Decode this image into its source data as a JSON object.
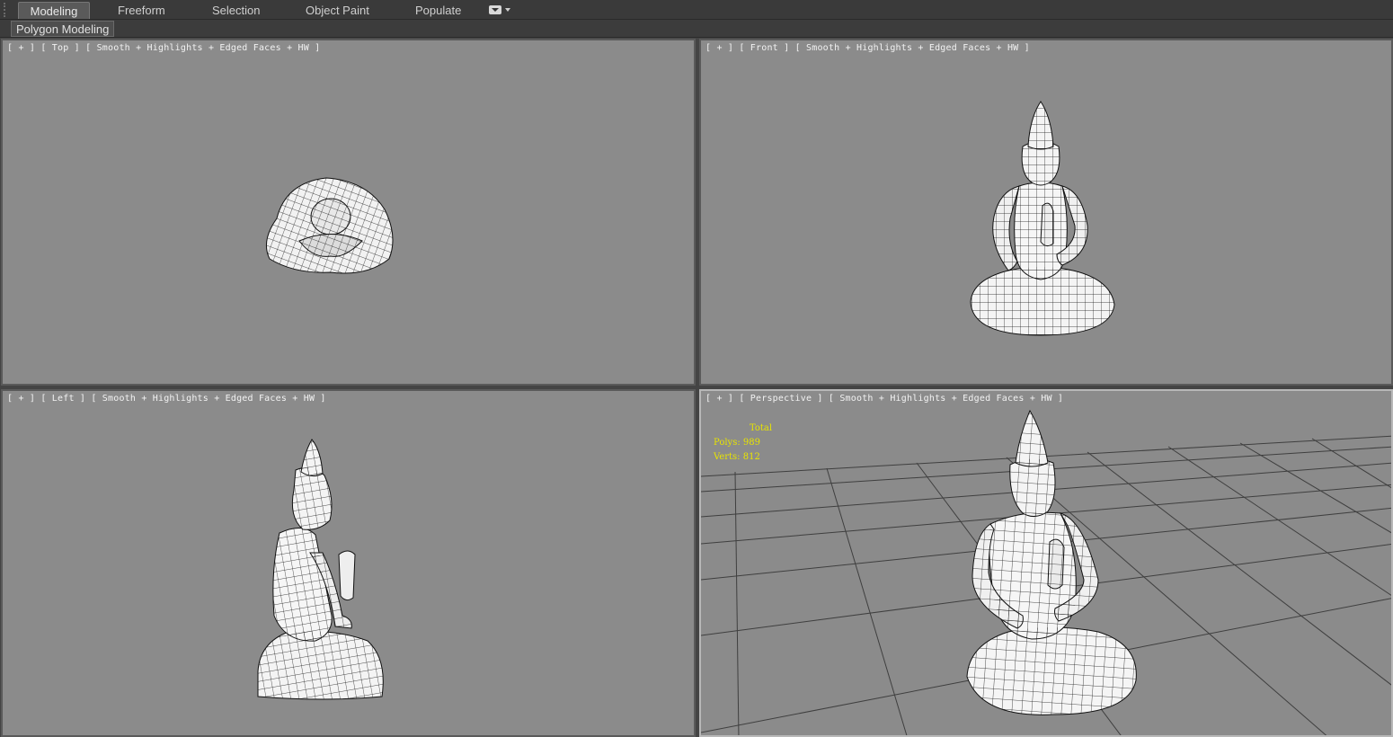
{
  "ribbon": {
    "tabs": [
      {
        "label": "Modeling",
        "active": true
      },
      {
        "label": "Freeform",
        "active": false
      },
      {
        "label": "Selection",
        "active": false
      },
      {
        "label": "Object Paint",
        "active": false
      },
      {
        "label": "Populate",
        "active": false
      }
    ],
    "panel_label": "Polygon Modeling"
  },
  "viewports": {
    "top": {
      "plus": "[ + ]",
      "view": "[ Top ]",
      "shading": "[ Smooth + Highlights + Edged Faces + HW ]"
    },
    "front": {
      "plus": "[ + ]",
      "view": "[ Front ]",
      "shading": "[ Smooth + Highlights + Edged Faces + HW ]"
    },
    "left": {
      "plus": "[ + ]",
      "view": "[ Left ]",
      "shading": "[ Smooth + Highlights + Edged Faces + HW ]"
    },
    "perspective": {
      "plus": "[ + ]",
      "view": "[ Perspective ]",
      "shading": "[ Smooth + Highlights + Edged Faces + HW ]"
    }
  },
  "statistics": {
    "header": "Total",
    "polys_label": "Polys:",
    "polys_value": "989",
    "verts_label": "Verts:",
    "verts_value": "812"
  },
  "colors": {
    "viewport_bg": "#8b8b8b",
    "ui_dark": "#3a3a3a",
    "stats_text": "#e8e400",
    "mesh_fill": "#f4f4f4",
    "mesh_edge": "#111111"
  }
}
